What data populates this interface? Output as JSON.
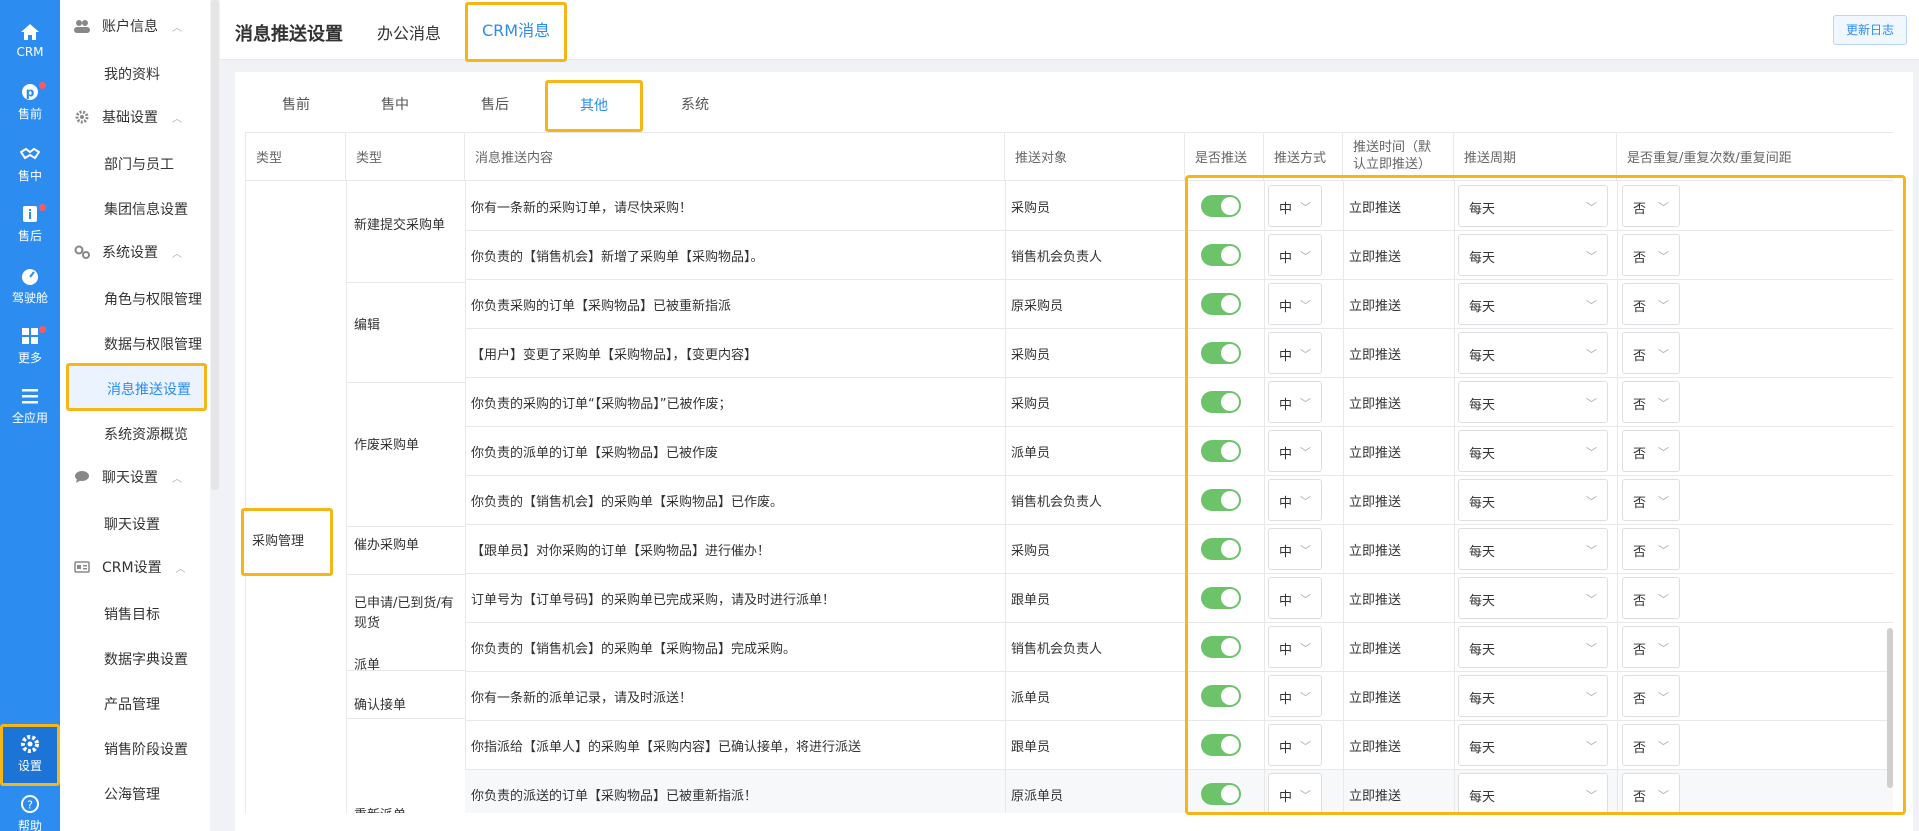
{
  "rail": {
    "items": [
      {
        "label": "CRM",
        "icon": "home-icon"
      },
      {
        "label": "售前",
        "icon": "pinterest-icon"
      },
      {
        "label": "售中",
        "icon": "handshake-icon"
      },
      {
        "label": "售后",
        "icon": "info-icon"
      },
      {
        "label": "驾驶舱",
        "icon": "dashboard-icon"
      },
      {
        "label": "更多",
        "icon": "grid-icon"
      },
      {
        "label": "全应用",
        "icon": "menu-icon"
      },
      {
        "label": "设置",
        "icon": "gear-icon"
      },
      {
        "label": "帮助",
        "icon": "help-icon"
      }
    ]
  },
  "menu": {
    "account": {
      "label": "账户信息",
      "items": [
        "我的资料"
      ]
    },
    "basic": {
      "label": "基础设置",
      "items": [
        "部门与员工",
        "集团信息设置"
      ]
    },
    "system": {
      "label": "系统设置",
      "items": [
        "角色与权限管理",
        "数据与权限管理",
        "消息推送设置",
        "系统资源概览"
      ]
    },
    "chat": {
      "label": "聊天设置",
      "items": [
        "聊天设置"
      ]
    },
    "crm": {
      "label": "CRM设置",
      "items": [
        "销售目标",
        "数据字典设置",
        "产品管理",
        "销售阶段设置",
        "公海管理"
      ]
    }
  },
  "header": {
    "title": "消息推送设置",
    "tabs": [
      "办公消息",
      "CRM消息"
    ],
    "changelog": "更新日志"
  },
  "subtabs": [
    "售前",
    "售中",
    "售后",
    "其他",
    "系统"
  ],
  "table": {
    "headers": {
      "cat1": "类型",
      "cat2": "类型",
      "content": "消息推送内容",
      "target": "推送对象",
      "enabled": "是否推送",
      "method": "推送方式",
      "time": "推送时间（默认立即推送）",
      "period": "推送周期",
      "repeat": "是否重复/重复次数/重复间距"
    },
    "category": "采购管理",
    "groups": [
      "新建提交采购单",
      "编辑",
      "作废采购单",
      "催办采购单",
      "已申请/已到货/有现货",
      "派单",
      "确认接单",
      "重新派单"
    ],
    "rows": [
      {
        "content": "你有一条新的采购订单，请尽快采购！",
        "target": "采购员",
        "method": "中",
        "time": "立即推送",
        "period": "每天",
        "repeat": "否",
        "on": true
      },
      {
        "content": "你负责的【销售机会】新增了采购单【采购物品】。",
        "target": "销售机会负责人",
        "method": "中",
        "time": "立即推送",
        "period": "每天",
        "repeat": "否",
        "on": true
      },
      {
        "content": "你负责采购的订单【采购物品】已被重新指派",
        "target": "原采购员",
        "method": "中",
        "time": "立即推送",
        "period": "每天",
        "repeat": "否",
        "on": true
      },
      {
        "content": "【用户】变更了采购单【采购物品】，【变更内容】",
        "target": "采购员",
        "method": "中",
        "time": "立即推送",
        "period": "每天",
        "repeat": "否",
        "on": true
      },
      {
        "content": "你负责的采购的订单“【采购物品】”已被作废；",
        "target": "采购员",
        "method": "中",
        "time": "立即推送",
        "period": "每天",
        "repeat": "否",
        "on": true
      },
      {
        "content": "你负责的派单的订单【采购物品】已被作废",
        "target": "派单员",
        "method": "中",
        "time": "立即推送",
        "period": "每天",
        "repeat": "否",
        "on": true
      },
      {
        "content": "你负责的【销售机会】的采购单【采购物品】已作废。",
        "target": "销售机会负责人",
        "method": "中",
        "time": "立即推送",
        "period": "每天",
        "repeat": "否",
        "on": true
      },
      {
        "content": "【跟单员】对你采购的订单【采购物品】进行催办！",
        "target": "采购员",
        "method": "中",
        "time": "立即推送",
        "period": "每天",
        "repeat": "否",
        "on": true
      },
      {
        "content": "订单号为【订单号码】的采购单已完成采购，请及时进行派单！",
        "target": "跟单员",
        "method": "中",
        "time": "立即推送",
        "period": "每天",
        "repeat": "否",
        "on": true
      },
      {
        "content": "你负责的【销售机会】的采购单【采购物品】完成采购。",
        "target": "销售机会负责人",
        "method": "中",
        "time": "立即推送",
        "period": "每天",
        "repeat": "否",
        "on": true
      },
      {
        "content": "你有一条新的派单记录，请及时派送！",
        "target": "派单员",
        "method": "中",
        "time": "立即推送",
        "period": "每天",
        "repeat": "否",
        "on": true
      },
      {
        "content": "你指派给【派单人】的采购单【采购内容】已确认接单，将进行派送",
        "target": "跟单员",
        "method": "中",
        "time": "立即推送",
        "period": "每天",
        "repeat": "否",
        "on": true
      },
      {
        "content": "你负责的派送的订单【采购物品】已被重新指派！",
        "target": "原派单员",
        "method": "中",
        "time": "立即推送",
        "period": "每天",
        "repeat": "否",
        "on": true
      }
    ]
  },
  "colors": {
    "accent": "#2d8cf0",
    "highlight": "#f6b617",
    "switch_on": "#6cc36a"
  }
}
